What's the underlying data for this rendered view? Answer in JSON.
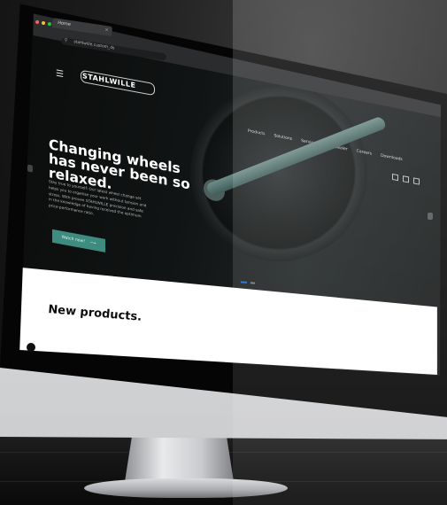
{
  "browser": {
    "tab_title": "Home",
    "tab_close": "×",
    "new_tab": "+",
    "url": "stahlwille.custom_ds"
  },
  "site": {
    "logo": "STAHLWILLE",
    "nav": [
      "Products",
      "Solutions",
      "Service",
      "Your Dealer",
      "Careers",
      "Downloads"
    ]
  },
  "hero": {
    "title": "Changing wheels has never been so relaxed.",
    "text": "Stay true to yourself: Our latest wheel change set helps you to organise your work without tension and stress. With proven STAHLWILLE precision and safe in the knowledge of having received the optimum price-performance ratio.",
    "cta_label": "Watch now!",
    "cta_arrow": "⟶"
  },
  "products": {
    "title": "New products."
  },
  "colors": {
    "accent": "#3e8c80",
    "hero_bg": "#111414"
  }
}
